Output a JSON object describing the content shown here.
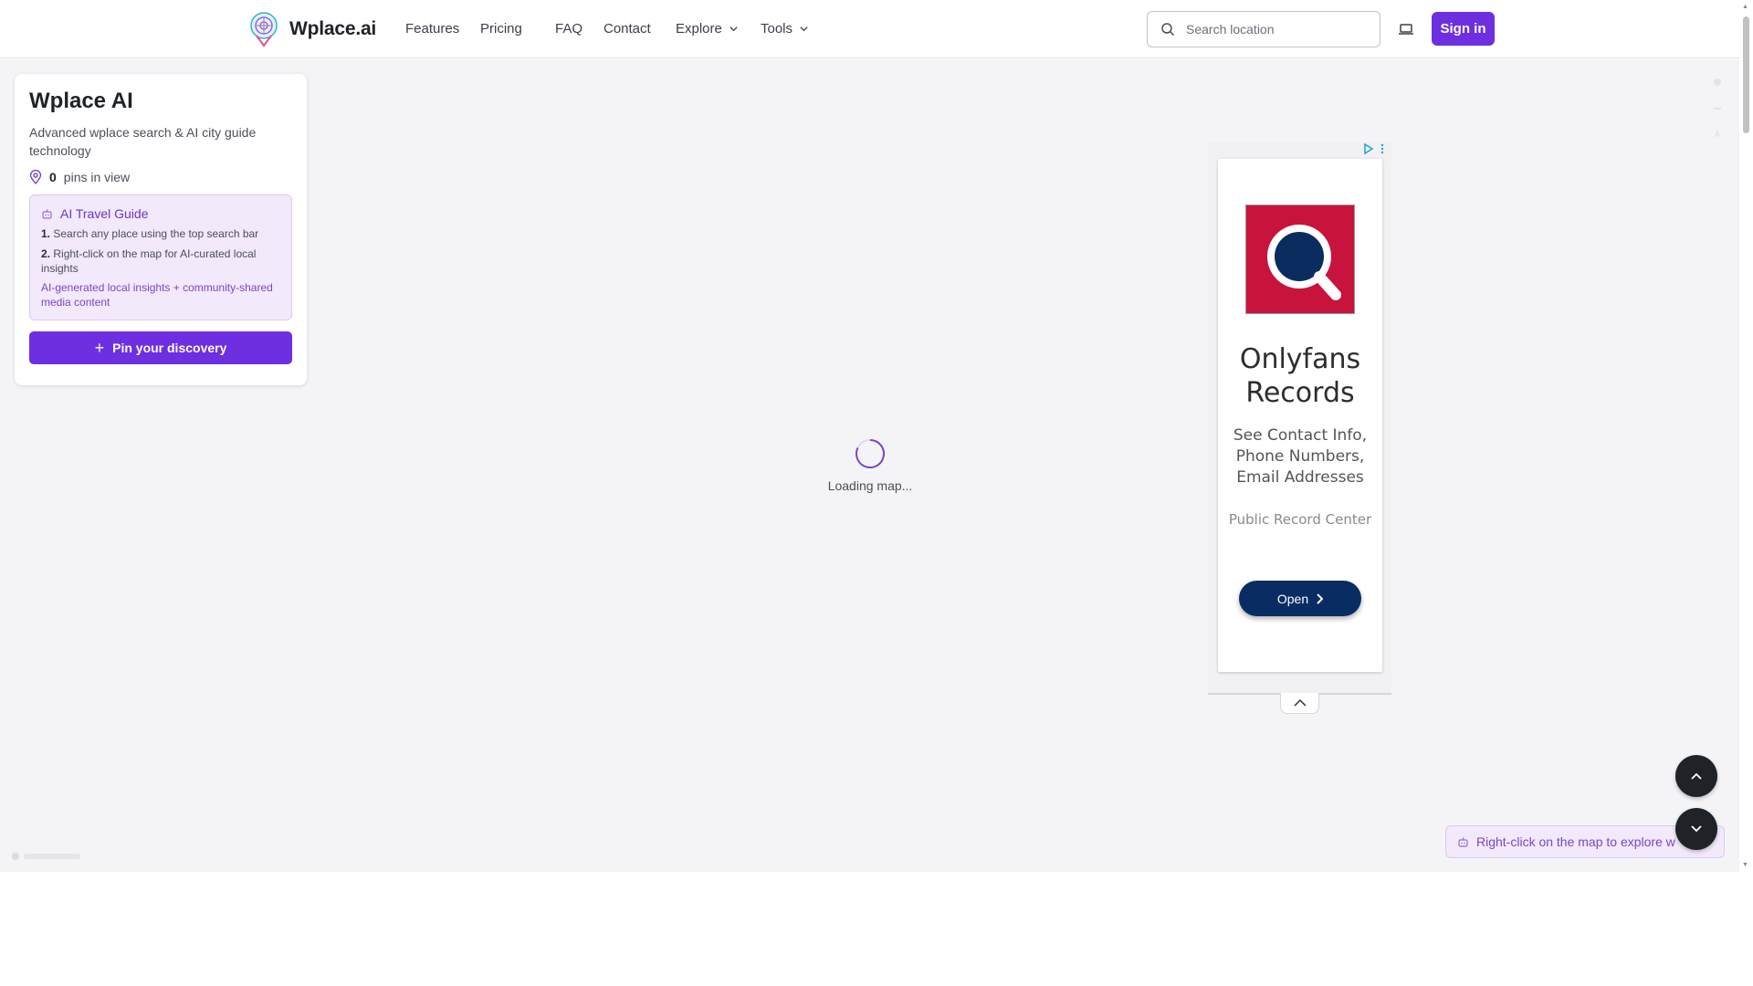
{
  "header": {
    "brand": "Wplace.ai",
    "nav": [
      {
        "label": "Features",
        "dropdown": false
      },
      {
        "label": "Pricing",
        "dropdown": false
      },
      {
        "label": "FAQ",
        "dropdown": false
      },
      {
        "label": "Contact",
        "dropdown": false
      },
      {
        "label": "Explore",
        "dropdown": true
      },
      {
        "label": "Tools",
        "dropdown": true
      }
    ],
    "search_placeholder": "Search location",
    "signin_label": "Sign in"
  },
  "info_card": {
    "title": "Wplace AI",
    "description": "Advanced wplace search & AI city guide technology",
    "pins_count": "0",
    "pins_label": "pins in view",
    "guide": {
      "title": "AI Travel Guide",
      "step1_num": "1.",
      "step1": "Search any place using the top search bar",
      "step2_num": "2.",
      "step2": "Right-click on the map for AI-curated local insights",
      "note": "AI-generated local insights + community-shared media content"
    },
    "pin_button": "Pin your discovery"
  },
  "map": {
    "loading_text": "Loading map...",
    "hint": "Right-click on the map to explore w"
  },
  "ad": {
    "title": "Onlyfans Records",
    "description": "See Contact Info, Phone Numbers, Email Addresses",
    "source": "Public Record Center",
    "open_label": "Open"
  },
  "colors": {
    "accent": "#6d2fe0",
    "guide_bg": "#f2e9fb",
    "map_bg": "#f4f4f7",
    "ad_logo": "#c8133d",
    "ad_button": "#092d63"
  },
  "icons": [
    "logo-icon",
    "chevron-down-icon",
    "search-icon",
    "laptop-icon",
    "map-pin-icon",
    "robot-icon",
    "plus-icon",
    "spinner-icon",
    "ad-choices-icon",
    "chevron-right-icon",
    "chevron-up-icon"
  ]
}
